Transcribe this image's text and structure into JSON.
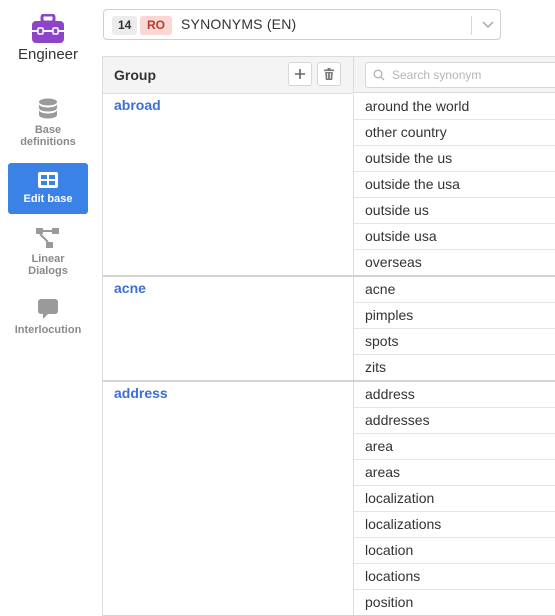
{
  "app": {
    "name": "Engineer"
  },
  "sidebar": {
    "items": [
      {
        "label1": "Base",
        "label2": "definitions",
        "icon": "database-icon"
      },
      {
        "label1": "Edit base",
        "label2": "",
        "icon": "table-icon",
        "active": true
      },
      {
        "label1": "Linear",
        "label2": "Dialogs",
        "icon": "flow-icon"
      },
      {
        "label1": "Interlocution",
        "label2": "",
        "icon": "chat-icon"
      }
    ]
  },
  "base_selector": {
    "count": "14",
    "lang": "RO",
    "name": "SYNONYMS (EN)"
  },
  "table": {
    "group_header": "Group",
    "search_placeholder": "Search synonym",
    "groups": [
      {
        "name": "abroad",
        "synonyms": [
          "around the world",
          "other country",
          "outside the us",
          "outside the usa",
          "outside us",
          "outside usa",
          "overseas"
        ]
      },
      {
        "name": "acne",
        "synonyms": [
          "acne",
          "pimples",
          "spots",
          "zits"
        ]
      },
      {
        "name": "address",
        "synonyms": [
          "address",
          "addresses",
          "area",
          "areas",
          "localization",
          "localizations",
          "location",
          "locations",
          "position"
        ]
      }
    ]
  },
  "colors": {
    "accent": "#3b82e6",
    "brand": "#8e44c8",
    "link": "#3b6fd6",
    "lang_badge_bg": "#fbd7d4",
    "lang_badge_text": "#c0392b"
  }
}
